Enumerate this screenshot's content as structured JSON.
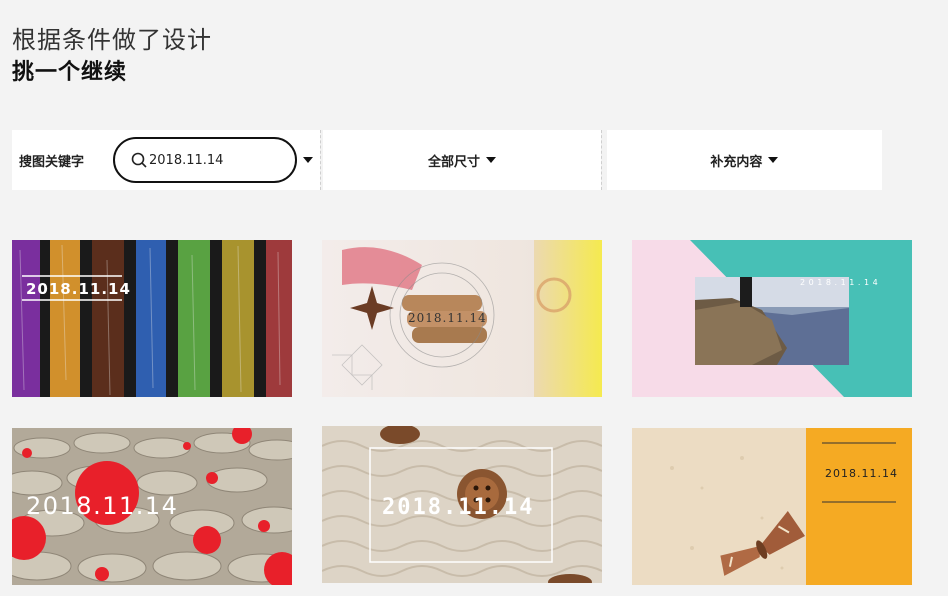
{
  "header": {
    "line1": "根据条件做了设计",
    "line2": "挑一个继续"
  },
  "filters": {
    "keyword_label": "搜图关键字",
    "search_value": "2018.11.14",
    "size_label": "全部尺寸",
    "extra_label": "补充内容"
  },
  "cards": [
    {
      "date": "2018.11.14"
    },
    {
      "date": "2018.11.14"
    },
    {
      "date": "2 0 1 8 . 1 1 . 1 4"
    },
    {
      "date": "2018.11.14"
    },
    {
      "date": "2018.11.14"
    },
    {
      "date": "2018.11.14"
    }
  ],
  "colors": {
    "teal": "#47c0b6",
    "pink": "#f7dbe8",
    "red": "#e8202a",
    "orange": "#f5aa23",
    "yellow": "#f2ee55"
  }
}
